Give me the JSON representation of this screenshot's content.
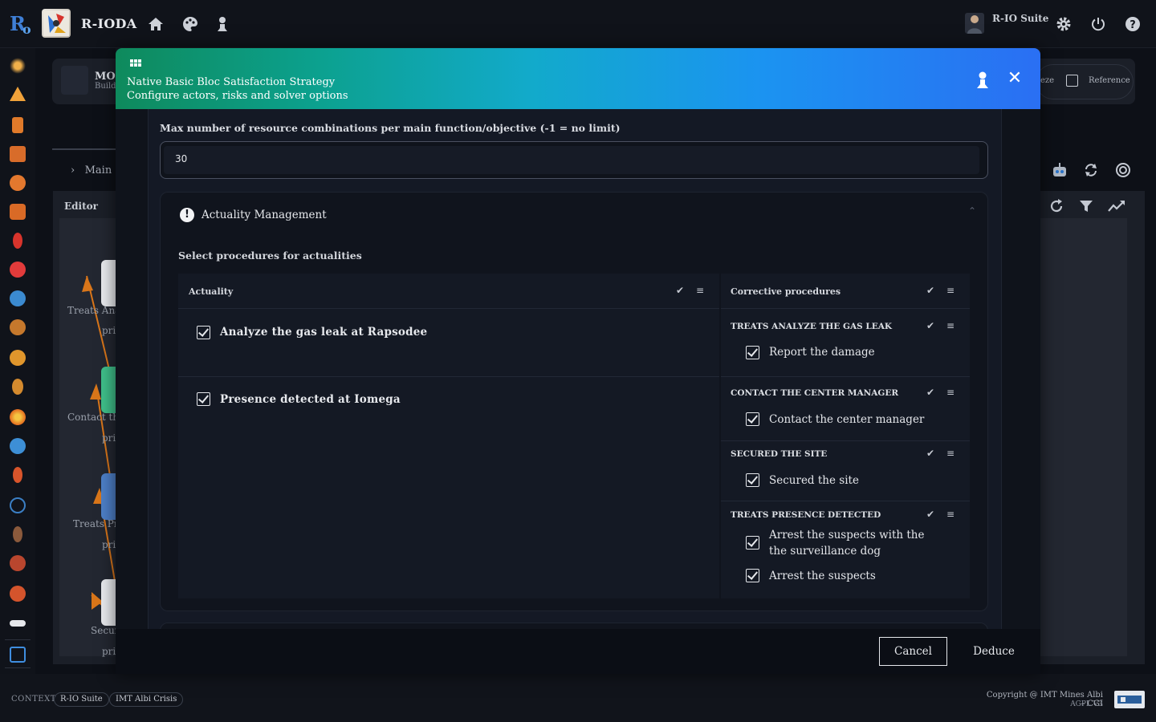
{
  "app": {
    "name": "R-IODA",
    "user_name": "R-IO Suite"
  },
  "background": {
    "card_title": "MO",
    "card_subtitle": "Build",
    "freeze_label": "eze",
    "reference_label": "Reference",
    "breadcrumb": "Main",
    "editor_label": "Editor",
    "nodes": [
      {
        "line1": "Treats Analy",
        "line2": "pri"
      },
      {
        "line1": "Contact the",
        "line2": "pri"
      },
      {
        "line1": "Treats Pres",
        "line2": "pri"
      },
      {
        "line1": "Secur",
        "line2": "pri"
      }
    ]
  },
  "modal": {
    "title": "Native Basic Bloc Satisfaction Strategy",
    "subtitle": "Configure actors, risks and solver options",
    "field_label": "Max number of resource combinations per main function/objective (-1 = no limit)",
    "field_value": "30",
    "section_title": "Actuality Management",
    "select_label": "Select procedures for actualities",
    "col_actuality": "Actuality",
    "col_procedures": "Corrective procedures",
    "actualities": [
      {
        "label": "Analyze the gas leak at Rapsodee",
        "checked": true
      },
      {
        "label": "Presence detected at Iomega",
        "checked": true
      }
    ],
    "procedure_groups": [
      {
        "title": "TREATS ANALYZE THE GAS LEAK",
        "items": [
          "Report the damage"
        ]
      },
      {
        "title": "CONTACT THE CENTER MANAGER",
        "items": [
          "Contact the center manager"
        ]
      },
      {
        "title": "SECURED THE SITE",
        "items": [
          "Secured the site"
        ]
      },
      {
        "title": "TREATS PRESENCE DETECTED",
        "items": [
          "Arrest the suspects with the the surveillance dog",
          "Arrest the suspects"
        ]
      }
    ],
    "cancel_label": "Cancel",
    "deduce_label": "Deduce"
  },
  "footer": {
    "context_label": "CONTEXT",
    "chip1": "R-IO Suite",
    "chip2": "IMT Albi Crisis",
    "copyright": "Copyright @ IMT Mines Albi – CGI",
    "license": "AGPL V3"
  },
  "colors": {
    "accent_gradient_start": "#0e8a5c",
    "accent_gradient_end": "#2a6ff3",
    "edge_orange": "#d9761a"
  }
}
